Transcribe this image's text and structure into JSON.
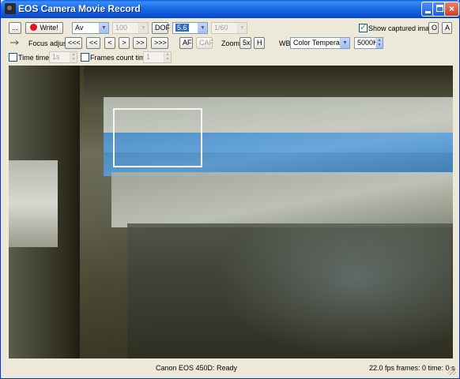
{
  "window": {
    "title": "EOS Camera Movie Record"
  },
  "toolbar": {
    "browse_label": "...",
    "write_label": "Write!",
    "mode": "Av",
    "iso": "100",
    "dof_label": "DOF",
    "aperture": "5.6",
    "shutter": "1/60",
    "show_captured_label": "Show captured image",
    "show_captured_checked": true,
    "o_label": "O",
    "a_label": "A"
  },
  "focus": {
    "label": "Focus adjust",
    "buttons": [
      "<<<",
      "<<",
      "<",
      ">",
      ">>",
      ">>>"
    ],
    "af_label": "AF",
    "caf_label": "CAF",
    "zoom_label": "Zoom",
    "zoom_5x": "5x",
    "zoom_h": "H",
    "wb_label": "WB",
    "wb_value": "Color Temperature",
    "temp_value": "5000K"
  },
  "timer": {
    "time_timer_label": "Time timer",
    "time_timer_checked": false,
    "time_value": "1s",
    "frames_label": "Frames count timer",
    "frames_checked": false,
    "frames_value": "1"
  },
  "status": {
    "camera": "Canon EOS 450D: Ready",
    "stats": "22.0 fps  frames: 0  time: 0 s"
  },
  "colors": {
    "titlebar": "#0b4fd1",
    "window_bg": "#ece9d8",
    "record": "#e0121b",
    "selection": "#316ac5"
  }
}
